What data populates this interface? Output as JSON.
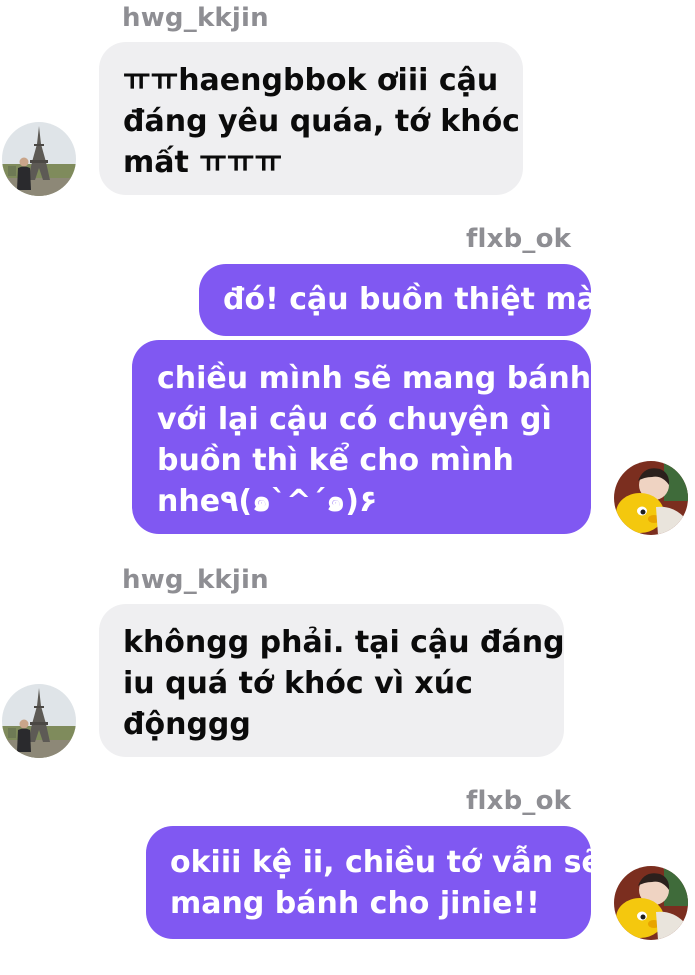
{
  "messages": [
    {
      "direction": "incoming",
      "sender": "hwg_kkjin",
      "lines": [
        "ㅠㅠhaengbbok ơiii cậu",
        "đáng yêu quáa, tớ khóc",
        "mất ㅠㅠㅠ"
      ]
    },
    {
      "direction": "outgoing",
      "sender": "flxb_ok",
      "lines": [
        "đó! cậu buồn thiệt mà"
      ]
    },
    {
      "direction": "outgoing",
      "lines": [
        "chiều mình sẽ mang bánh",
        "với lại cậu có chuyện gì",
        "buồn thì kể cho mình",
        "nhe٩(๑`^´๑)۶"
      ]
    },
    {
      "direction": "incoming",
      "sender": "hwg_kkjin",
      "lines": [
        "khôngg phải. tại cậu đáng",
        "iu quá tớ khóc vì xúc",
        "độnggg"
      ]
    },
    {
      "direction": "outgoing",
      "sender": "flxb_ok",
      "lines": [
        "okiii kệ ii, chiều tớ vẫn sẽ",
        "mang bánh cho jinie!!"
      ]
    }
  ],
  "avatars": {
    "hwg_kkjin": "eiffel-tower-photo",
    "flxb_ok": "person-with-yellow-plush"
  },
  "colors": {
    "incoming_bubble": "#efeff1",
    "outgoing_bubble": "#8058f2",
    "sender_name": "#8e8e93",
    "incoming_text": "#0b0b0b",
    "outgoing_text": "#ffffff"
  }
}
